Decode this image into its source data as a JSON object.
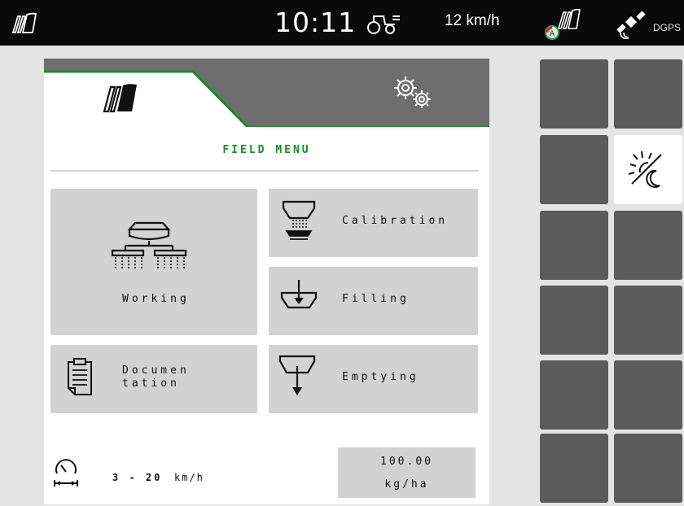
{
  "statusbar": {
    "time": "10:11",
    "speed": "12 km/h",
    "gps_label": "DGPS",
    "icons": [
      "machine-logo-icon",
      "tractor-icon",
      "gps-signal-icon",
      "satellite-icon"
    ]
  },
  "tabs": {
    "home_icon": "machine-logo-icon",
    "settings_icon": "gears-icon"
  },
  "menu": {
    "title": "FIELD MENU",
    "tiles": {
      "working": "Working",
      "calibration": "Calibration",
      "filling": "Filling",
      "documentation_line1": "Documen",
      "documentation_line2": "tation",
      "emptying": "Emptying"
    }
  },
  "footer": {
    "speed_range": "3 - 20",
    "speed_unit": "km/h",
    "rate_value": "100.00",
    "rate_unit": "kg/ha"
  },
  "softkeys": {
    "day_night_icon": "day-night-icon"
  },
  "colors": {
    "accent_green": "#1b8a2e",
    "tab_gray": "#6e6e6e",
    "tile_gray": "#d2d2d2",
    "softkey_gray": "#5b5b5b"
  }
}
